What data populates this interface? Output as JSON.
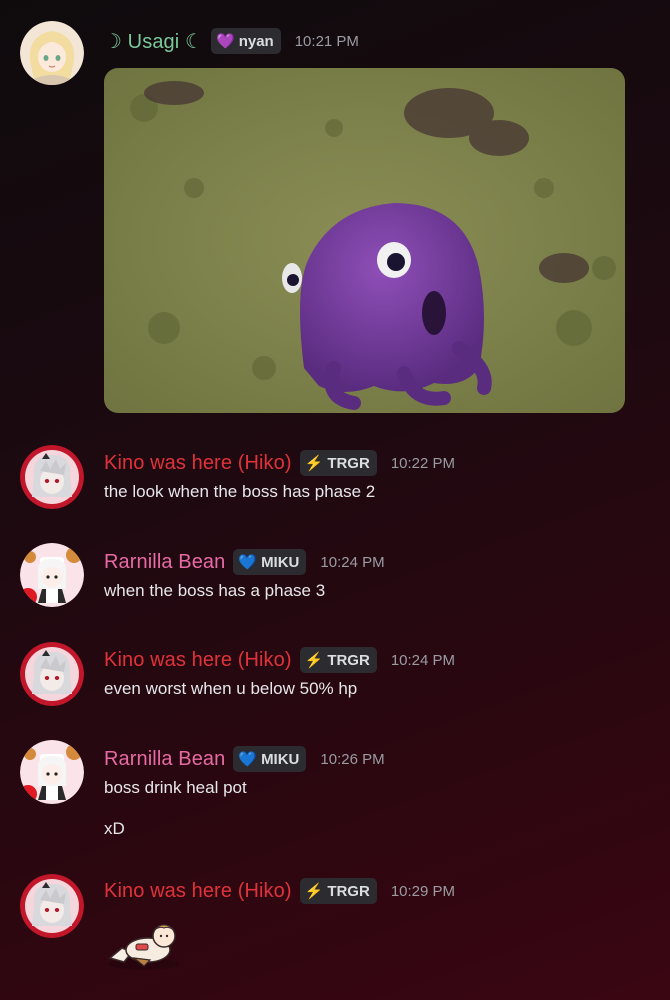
{
  "messages": [
    {
      "author": "☽ Usagi ☾",
      "author_color": "#7bc99a",
      "tag": {
        "icon": "purple-heart-icon",
        "glyph": "💜",
        "label": "nyan"
      },
      "time": "10:21 PM",
      "attachment": "gif-image"
    },
    {
      "author": "Kino was here (Hiko)",
      "author_color": "#e0323a",
      "tag": {
        "icon": "lightning-icon",
        "glyph": "⚡",
        "label": "TRGR"
      },
      "time": "10:22 PM",
      "lines": [
        "the look when the boss has phase 2"
      ]
    },
    {
      "author": "Rarnilla Bean",
      "author_color": "#e86aa4",
      "tag": {
        "icon": "cyan-heart-icon",
        "glyph": "💙",
        "label": "MIKU"
      },
      "time": "10:24 PM",
      "lines": [
        "when the boss has a phase 3"
      ]
    },
    {
      "author": "Kino was here (Hiko)",
      "author_color": "#e0323a",
      "tag": {
        "icon": "lightning-icon",
        "glyph": "⚡",
        "label": "TRGR"
      },
      "time": "10:24 PM",
      "lines": [
        "even worst when u below 50% hp"
      ]
    },
    {
      "author": "Rarnilla Bean",
      "author_color": "#e86aa4",
      "tag": {
        "icon": "cyan-heart-icon",
        "glyph": "💙",
        "label": "MIKU"
      },
      "time": "10:26 PM",
      "lines": [
        "boss drink heal pot",
        "xD"
      ]
    },
    {
      "author": "Kino was here (Hiko)",
      "author_color": "#e0323a",
      "tag": {
        "icon": "lightning-icon",
        "glyph": "⚡",
        "label": "TRGR"
      },
      "time": "10:29 PM",
      "attachment": "sticker"
    }
  ]
}
